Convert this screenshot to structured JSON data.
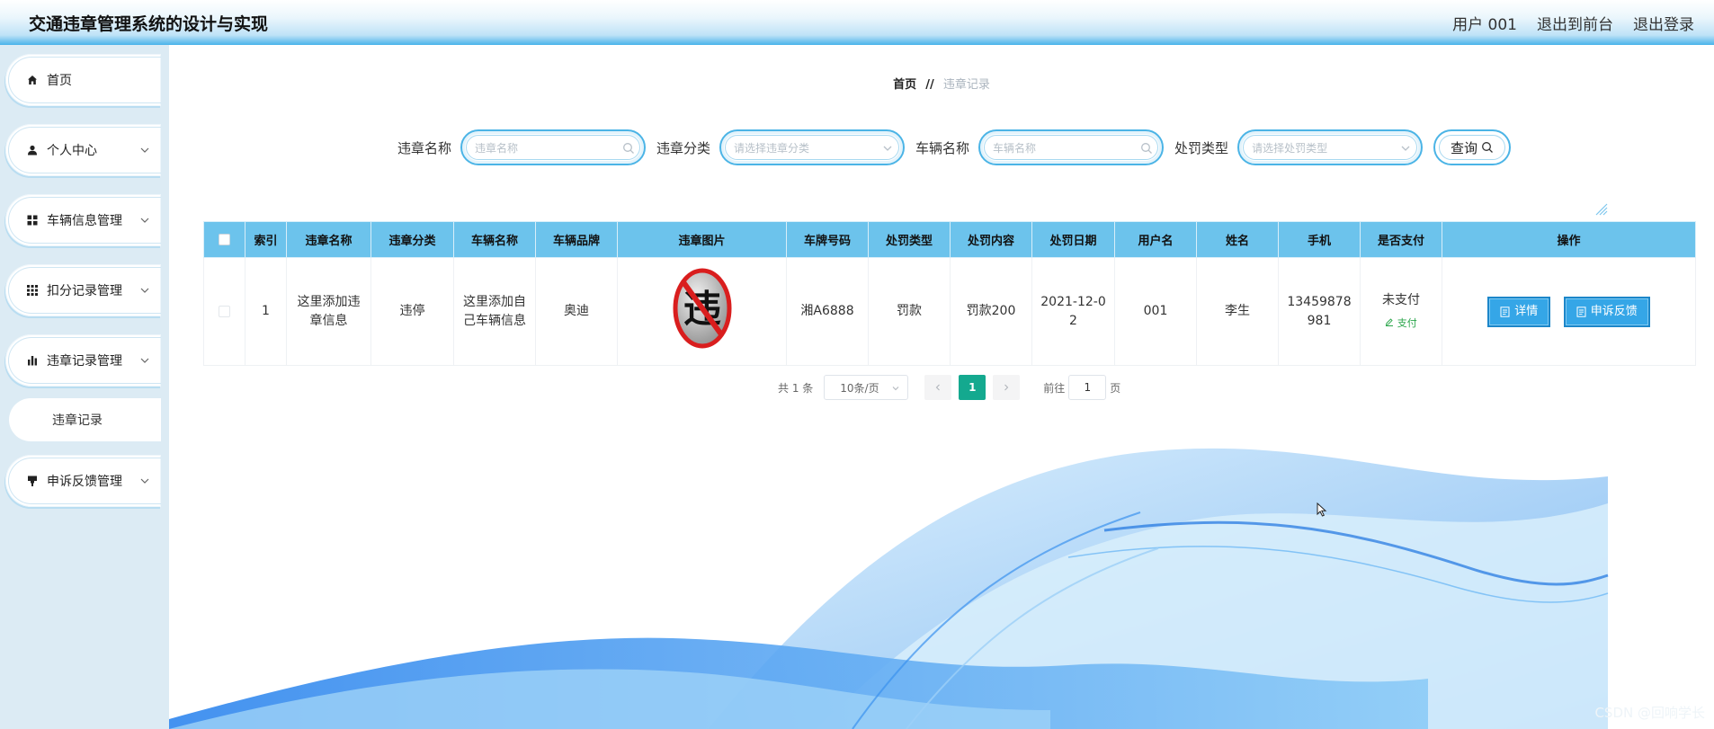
{
  "header": {
    "title": "交通违章管理系统的设计与实现",
    "user": "用户 001",
    "to_front": "退出到前台",
    "logout": "退出登录"
  },
  "sidebar": {
    "items": [
      {
        "label": "首页",
        "icon": "home-icon"
      },
      {
        "label": "个人中心",
        "icon": "user-icon"
      },
      {
        "label": "车辆信息管理",
        "icon": "grid-icon"
      },
      {
        "label": "扣分记录管理",
        "icon": "apps-icon"
      },
      {
        "label": "违章记录管理",
        "icon": "bar-chart-icon"
      },
      {
        "label": "申诉反馈管理",
        "icon": "flag-icon"
      }
    ],
    "submenu": {
      "label": "违章记录"
    }
  },
  "breadcrumb": {
    "home": "首页",
    "separator": "//",
    "current": "违章记录"
  },
  "search": {
    "name_label": "违章名称",
    "name_placeholder": "违章名称",
    "category_label": "违章分类",
    "category_placeholder": "请选择违章分类",
    "vehicle_label": "车辆名称",
    "vehicle_placeholder": "车辆名称",
    "penalty_label": "处罚类型",
    "penalty_placeholder": "请选择处罚类型",
    "query_label": "查询"
  },
  "table": {
    "headers": [
      "索引",
      "违章名称",
      "违章分类",
      "车辆名称",
      "车辆品牌",
      "违章图片",
      "车牌号码",
      "处罚类型",
      "处罚内容",
      "处罚日期",
      "用户名",
      "姓名",
      "手机",
      "是否支付",
      "操作"
    ],
    "rows": [
      {
        "index": "1",
        "violation_name": "这里添加违章信息",
        "category": "违停",
        "vehicle_name": "这里添加自己车辆信息",
        "brand": "奥迪",
        "image_text": "违",
        "plate": "湘A6888",
        "penalty_type": "罚款",
        "penalty_content": "罚款200",
        "penalty_date": "2021-12-02",
        "username": "001",
        "name": "李生",
        "phone": "13459878981",
        "paid_status": "未支付",
        "pay_action": "支付",
        "detail_btn": "详情",
        "appeal_btn": "申诉反馈"
      }
    ]
  },
  "pagination": {
    "total": "共 1 条",
    "page_size": "10条/页",
    "current_page": "1",
    "goto_label": "前往",
    "goto_value": "1",
    "page_suffix": "页"
  },
  "watermark": "CSDN @回响学长",
  "colors": {
    "accent": "#35a6e7",
    "header_row": "#6cc3ec",
    "pager_active": "#14a98f",
    "pay_green": "#2aa54a"
  }
}
